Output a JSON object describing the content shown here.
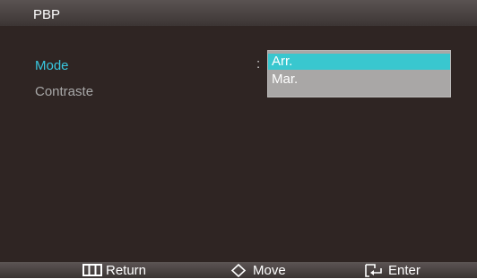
{
  "header": {
    "title": "PBP"
  },
  "menu": {
    "items": [
      {
        "label": "Mode",
        "state": "active"
      },
      {
        "label": "Contraste",
        "state": "inactive"
      }
    ],
    "separator": ":"
  },
  "dropdown": {
    "options": [
      "Arr.",
      "Mar."
    ],
    "selected": "Arr."
  },
  "footer": {
    "return_label": "Return",
    "move_label": "Move",
    "enter_label": "Enter"
  },
  "colors": {
    "background": "#2f2523",
    "header_bar": "#4a4342",
    "active_item": "#38c8e0",
    "inactive_item": "#a8a8a8",
    "highlight": "#39c7cf",
    "dropdown_bg": "#a9a7a6"
  }
}
